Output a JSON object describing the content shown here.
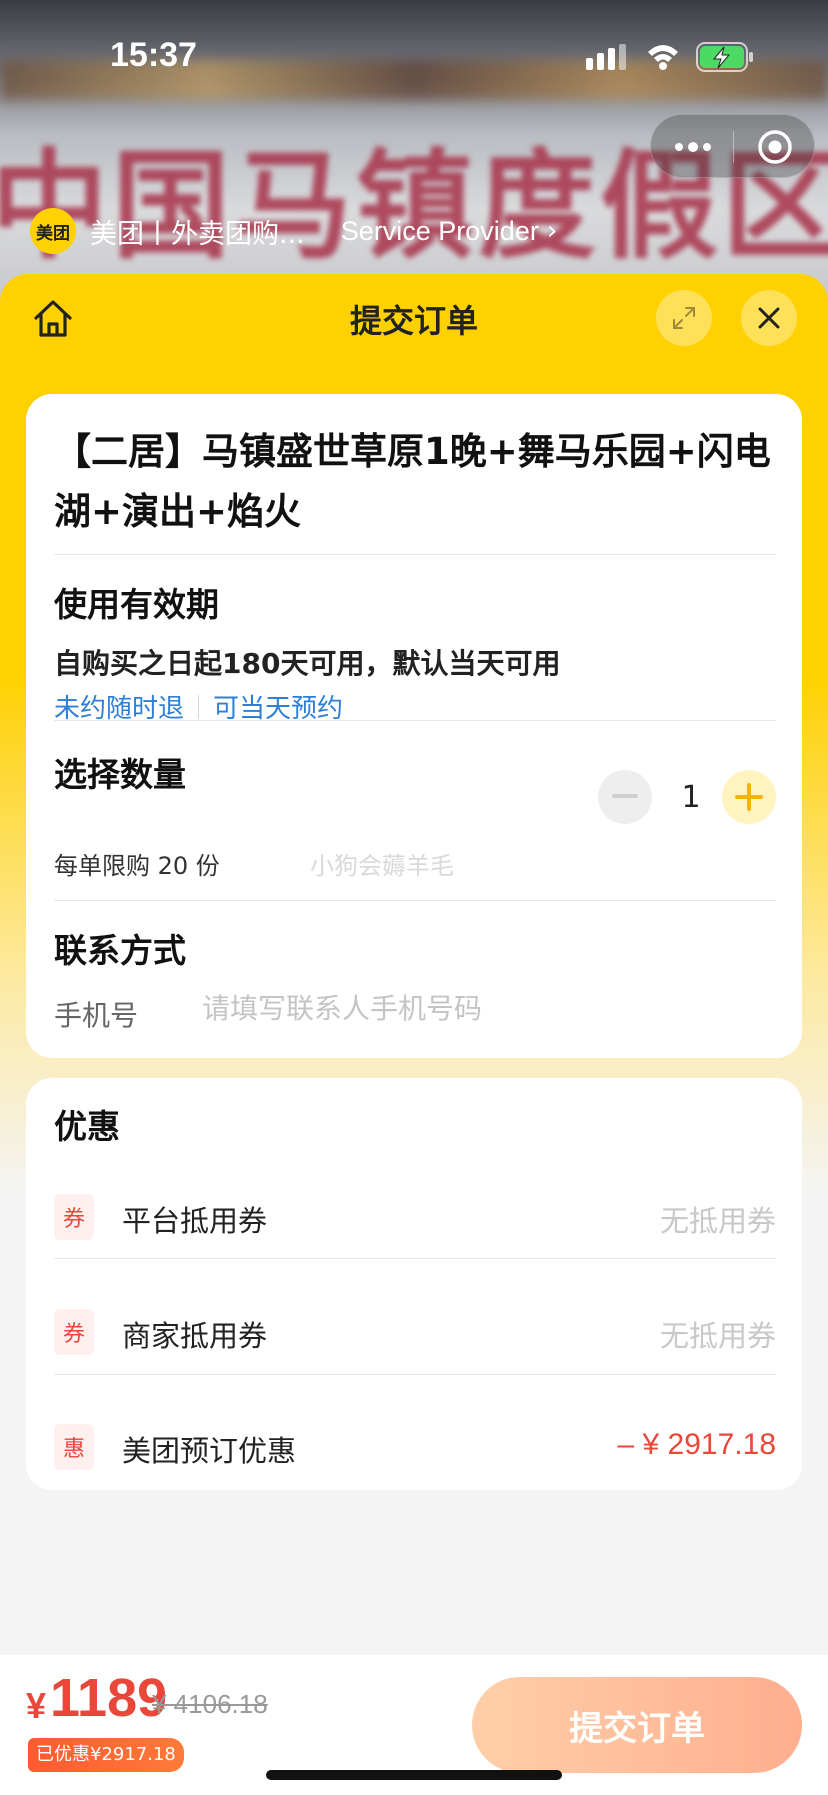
{
  "status_bar": {
    "time": "15:37"
  },
  "provider": {
    "logo_text": "美团",
    "name": "美团丨外卖团购...",
    "link": "Service Provider",
    "chevron": "›"
  },
  "background": {
    "banner_text": "中国马镇度假区"
  },
  "sheet": {
    "title": "提交订单"
  },
  "product": {
    "title": "【二居】马镇盛世草原1晚+舞马乐园+闪电湖+演出+焰火"
  },
  "validity": {
    "label": "使用有效期",
    "text": "自购买之日起180天可用，默认当天可用",
    "tags": [
      "未约随时退",
      "可当天预约"
    ]
  },
  "quantity": {
    "label": "选择数量",
    "value": "1",
    "limit_text": "每单限购 20 份",
    "watermark": "小狗会薅羊毛"
  },
  "contact": {
    "label": "联系方式",
    "phone_label": "手机号",
    "phone_placeholder": "请填写联系人手机号码"
  },
  "discounts": {
    "label": "优惠",
    "items": [
      {
        "badge": "券",
        "name": "平台抵用券",
        "value": "无抵用券"
      },
      {
        "badge": "券",
        "name": "商家抵用券",
        "value": "无抵用券"
      },
      {
        "badge": "惠",
        "name": "美团预订优惠",
        "value": "– ¥ 2917.18"
      }
    ]
  },
  "footer": {
    "currency": "¥",
    "price": "1189",
    "original_price": "¥ 4106.18",
    "saved": "已优惠¥2917.18",
    "submit_label": "提交订单"
  },
  "colors": {
    "brand_yellow": "#ffd100",
    "price_red": "#e8473a",
    "link_blue": "#2e7fd6"
  }
}
